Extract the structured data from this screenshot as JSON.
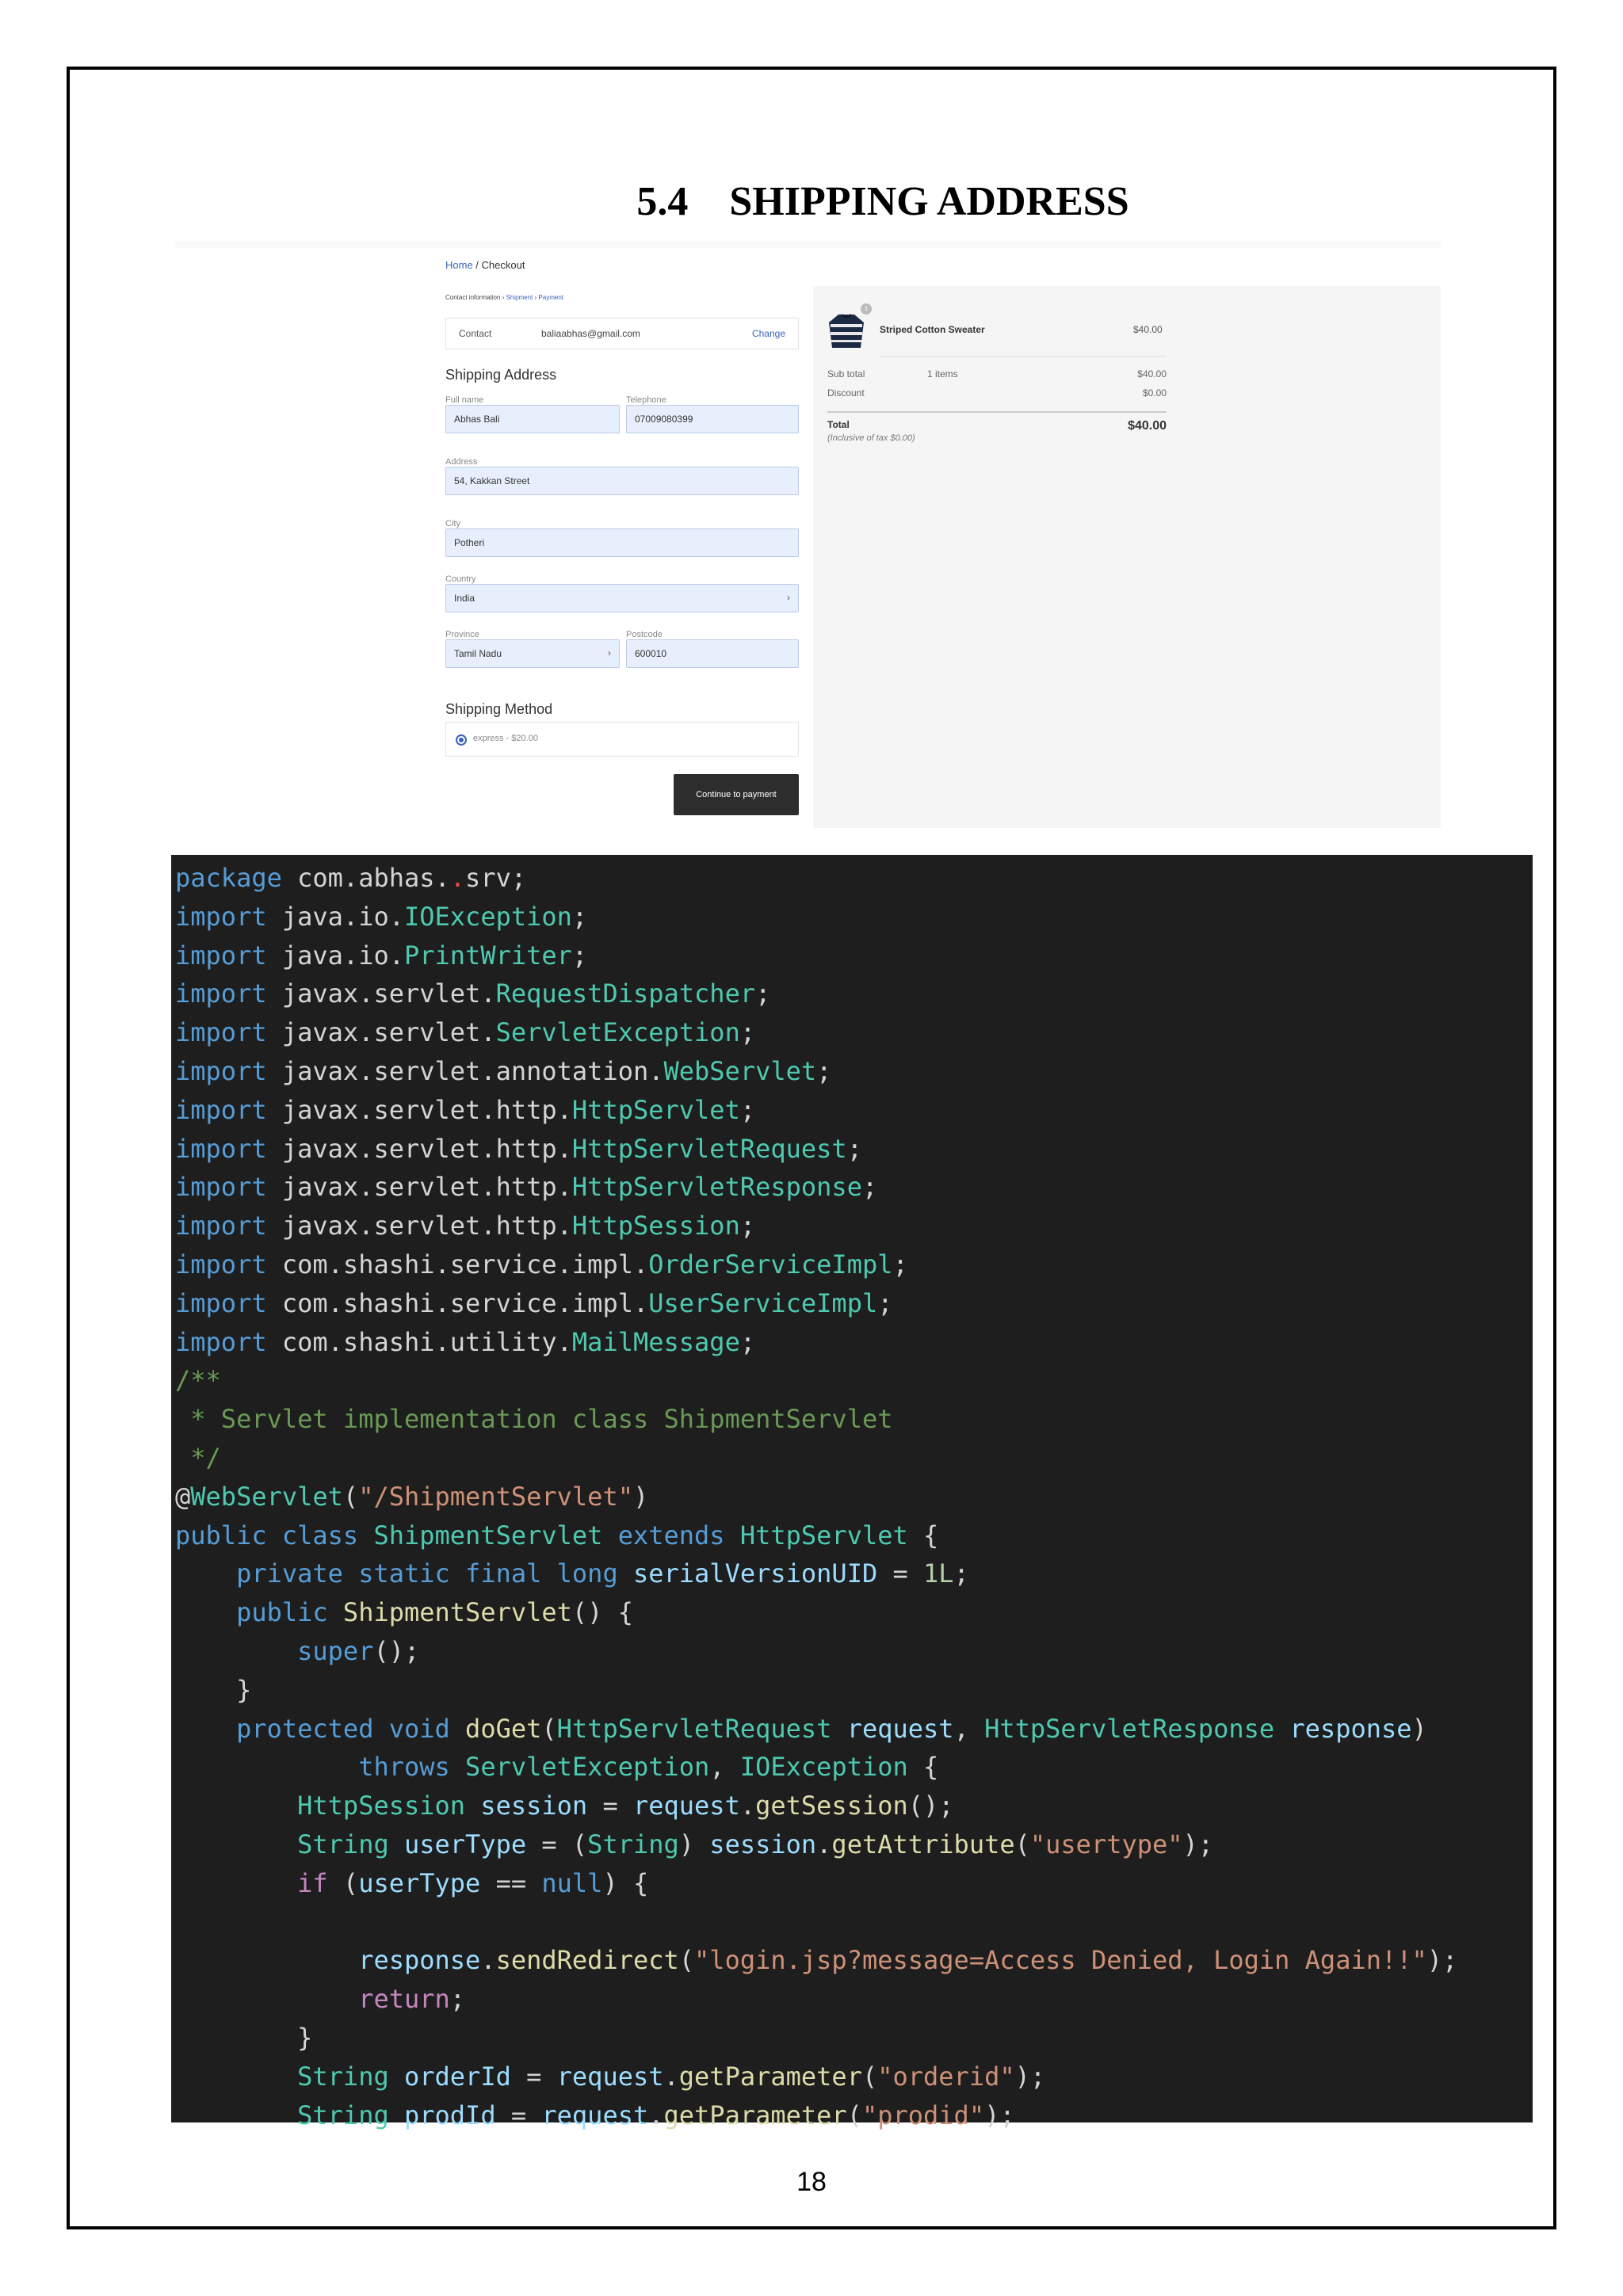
{
  "heading": {
    "number": "5.4",
    "title": "SHIPPING ADDRESS"
  },
  "screenshot": {
    "breadcrumb": {
      "home": "Home",
      "sep": " / ",
      "current": "Checkout"
    },
    "steps": [
      {
        "label": "Contact information",
        "link": false
      },
      {
        "label": "Shipment",
        "link": true
      },
      {
        "label": "Payment",
        "link": true
      }
    ],
    "contact": {
      "label": "Contact",
      "email": "baliaabhas@gmail.com",
      "change": "Change"
    },
    "shipping_title": "Shipping Address",
    "fields": {
      "full_name": {
        "label": "Full name",
        "value": "Abhas Bali"
      },
      "telephone": {
        "label": "Telephone",
        "value": "07009080399"
      },
      "address": {
        "label": "Address",
        "value": "54, Kakkan Street"
      },
      "city": {
        "label": "City",
        "value": "Potheri"
      },
      "country": {
        "label": "Country",
        "value": "India"
      },
      "province": {
        "label": "Province",
        "value": "Tamil Nadu"
      },
      "postcode": {
        "label": "Postcode",
        "value": "600010"
      }
    },
    "method_title": "Shipping Method",
    "method_option": "express - $20.00",
    "continue_label": "Continue to payment",
    "summary": {
      "qty": "1",
      "product": "Striped Cotton Sweater",
      "product_price": "$40.00",
      "subtotal_label": "Sub total",
      "items": "1 items",
      "subtotal": "$40.00",
      "discount_label": "Discount",
      "discount": "$0.00",
      "total_label": "Total",
      "total": "$40.00",
      "tax_note": "(Inclusive of tax $0.00)"
    }
  },
  "code_colors": {
    "kw": "#569cd6",
    "type": "#4ec9b0",
    "str": "#ce9178",
    "cmt": "#6a9955",
    "var": "#9cdcfe",
    "fn": "#dcdcaa",
    "ctl": "#c586c0",
    "num": "#b5cea8",
    "plain": "#d4d4d4",
    "err": "#f44747"
  },
  "code_lines": [
    [
      [
        "kw",
        "package"
      ],
      [
        "plain",
        " com.abhas."
      ],
      [
        "err",
        "."
      ],
      [
        "plain",
        "srv;"
      ]
    ],
    [
      [
        "kw",
        "import"
      ],
      [
        "plain",
        " java.io."
      ],
      [
        "type",
        "IOException"
      ],
      [
        "plain",
        ";"
      ]
    ],
    [
      [
        "kw",
        "import"
      ],
      [
        "plain",
        " java.io."
      ],
      [
        "type",
        "PrintWriter"
      ],
      [
        "plain",
        ";"
      ]
    ],
    [
      [
        "kw",
        "import"
      ],
      [
        "plain",
        " javax.servlet."
      ],
      [
        "type",
        "RequestDispatcher"
      ],
      [
        "plain",
        ";"
      ]
    ],
    [
      [
        "kw",
        "import"
      ],
      [
        "plain",
        " javax.servlet."
      ],
      [
        "type",
        "ServletException"
      ],
      [
        "plain",
        ";"
      ]
    ],
    [
      [
        "kw",
        "import"
      ],
      [
        "plain",
        " javax.servlet.annotation."
      ],
      [
        "type",
        "WebServlet"
      ],
      [
        "plain",
        ";"
      ]
    ],
    [
      [
        "kw",
        "import"
      ],
      [
        "plain",
        " javax.servlet.http."
      ],
      [
        "type",
        "HttpServlet"
      ],
      [
        "plain",
        ";"
      ]
    ],
    [
      [
        "kw",
        "import"
      ],
      [
        "plain",
        " javax.servlet.http."
      ],
      [
        "type",
        "HttpServletRequest"
      ],
      [
        "plain",
        ";"
      ]
    ],
    [
      [
        "kw",
        "import"
      ],
      [
        "plain",
        " javax.servlet.http."
      ],
      [
        "type",
        "HttpServletResponse"
      ],
      [
        "plain",
        ";"
      ]
    ],
    [
      [
        "kw",
        "import"
      ],
      [
        "plain",
        " javax.servlet.http."
      ],
      [
        "type",
        "HttpSession"
      ],
      [
        "plain",
        ";"
      ]
    ],
    [
      [
        "kw",
        "import"
      ],
      [
        "plain",
        " com.shashi.service.impl."
      ],
      [
        "type",
        "OrderServiceImpl"
      ],
      [
        "plain",
        ";"
      ]
    ],
    [
      [
        "kw",
        "import"
      ],
      [
        "plain",
        " com.shashi.service.impl."
      ],
      [
        "type",
        "UserServiceImpl"
      ],
      [
        "plain",
        ";"
      ]
    ],
    [
      [
        "kw",
        "import"
      ],
      [
        "plain",
        " com.shashi.utility."
      ],
      [
        "type",
        "MailMessage"
      ],
      [
        "plain",
        ";"
      ]
    ],
    [
      [
        "cmt",
        "/**"
      ]
    ],
    [
      [
        "cmt",
        " * Servlet implementation class ShipmentServlet"
      ]
    ],
    [
      [
        "cmt",
        " */"
      ]
    ],
    [
      [
        "plain",
        "@"
      ],
      [
        "type",
        "WebServlet"
      ],
      [
        "plain",
        "("
      ],
      [
        "str",
        "\"/ShipmentServlet\""
      ],
      [
        "plain",
        ")"
      ]
    ],
    [
      [
        "kw",
        "public"
      ],
      [
        "plain",
        " "
      ],
      [
        "kw",
        "class"
      ],
      [
        "plain",
        " "
      ],
      [
        "type",
        "ShipmentServlet"
      ],
      [
        "plain",
        " "
      ],
      [
        "kw",
        "extends"
      ],
      [
        "plain",
        " "
      ],
      [
        "type",
        "HttpServlet"
      ],
      [
        "plain",
        " {"
      ]
    ],
    [
      [
        "plain",
        "    "
      ],
      [
        "kw",
        "private"
      ],
      [
        "plain",
        " "
      ],
      [
        "kw",
        "static"
      ],
      [
        "plain",
        " "
      ],
      [
        "kw",
        "final"
      ],
      [
        "plain",
        " "
      ],
      [
        "kw",
        "long"
      ],
      [
        "plain",
        " "
      ],
      [
        "var",
        "serialVersionUID"
      ],
      [
        "plain",
        " = "
      ],
      [
        "num",
        "1L"
      ],
      [
        "plain",
        ";"
      ]
    ],
    [
      [
        "plain",
        "    "
      ],
      [
        "kw",
        "public"
      ],
      [
        "plain",
        " "
      ],
      [
        "fn",
        "ShipmentServlet"
      ],
      [
        "plain",
        "() {"
      ]
    ],
    [
      [
        "plain",
        "        "
      ],
      [
        "kw",
        "super"
      ],
      [
        "plain",
        "();"
      ]
    ],
    [
      [
        "plain",
        "    }"
      ]
    ],
    [
      [
        "plain",
        "    "
      ],
      [
        "kw",
        "protected"
      ],
      [
        "plain",
        " "
      ],
      [
        "kw",
        "void"
      ],
      [
        "plain",
        " "
      ],
      [
        "fn",
        "doGet"
      ],
      [
        "plain",
        "("
      ],
      [
        "type",
        "HttpServletRequest"
      ],
      [
        "plain",
        " "
      ],
      [
        "var",
        "request"
      ],
      [
        "plain",
        ", "
      ],
      [
        "type",
        "HttpServletResponse"
      ],
      [
        "plain",
        " "
      ],
      [
        "var",
        "response"
      ],
      [
        "plain",
        ")"
      ]
    ],
    [
      [
        "plain",
        "            "
      ],
      [
        "kw",
        "throws"
      ],
      [
        "plain",
        " "
      ],
      [
        "type",
        "ServletException"
      ],
      [
        "plain",
        ", "
      ],
      [
        "type",
        "IOException"
      ],
      [
        "plain",
        " {"
      ]
    ],
    [
      [
        "plain",
        "        "
      ],
      [
        "type",
        "HttpSession"
      ],
      [
        "plain",
        " "
      ],
      [
        "var",
        "session"
      ],
      [
        "plain",
        " = "
      ],
      [
        "var",
        "request"
      ],
      [
        "plain",
        "."
      ],
      [
        "fn",
        "getSession"
      ],
      [
        "plain",
        "();"
      ]
    ],
    [
      [
        "plain",
        "        "
      ],
      [
        "type",
        "String"
      ],
      [
        "plain",
        " "
      ],
      [
        "var",
        "userType"
      ],
      [
        "plain",
        " = ("
      ],
      [
        "type",
        "String"
      ],
      [
        "plain",
        ") "
      ],
      [
        "var",
        "session"
      ],
      [
        "plain",
        "."
      ],
      [
        "fn",
        "getAttribute"
      ],
      [
        "plain",
        "("
      ],
      [
        "str",
        "\"usertype\""
      ],
      [
        "plain",
        ");"
      ]
    ],
    [
      [
        "plain",
        "        "
      ],
      [
        "ctl",
        "if"
      ],
      [
        "plain",
        " ("
      ],
      [
        "var",
        "userType"
      ],
      [
        "plain",
        " == "
      ],
      [
        "kw",
        "null"
      ],
      [
        "plain",
        ") {"
      ]
    ],
    [
      [
        "plain",
        ""
      ]
    ],
    [
      [
        "plain",
        "            "
      ],
      [
        "var",
        "response"
      ],
      [
        "plain",
        "."
      ],
      [
        "fn",
        "sendRedirect"
      ],
      [
        "plain",
        "("
      ],
      [
        "str",
        "\"login.jsp?message=Access Denied, Login Again!!\""
      ],
      [
        "plain",
        ");"
      ]
    ],
    [
      [
        "plain",
        "            "
      ],
      [
        "ctl",
        "return"
      ],
      [
        "plain",
        ";"
      ]
    ],
    [
      [
        "plain",
        "        }"
      ]
    ],
    [
      [
        "plain",
        "        "
      ],
      [
        "type",
        "String"
      ],
      [
        "plain",
        " "
      ],
      [
        "var",
        "orderId"
      ],
      [
        "plain",
        " = "
      ],
      [
        "var",
        "request"
      ],
      [
        "plain",
        "."
      ],
      [
        "fn",
        "getParameter"
      ],
      [
        "plain",
        "("
      ],
      [
        "str",
        "\"orderid\""
      ],
      [
        "plain",
        ");"
      ]
    ],
    [
      [
        "plain",
        "        "
      ],
      [
        "type",
        "String"
      ],
      [
        "plain",
        " "
      ],
      [
        "var",
        "prodId"
      ],
      [
        "plain",
        " = "
      ],
      [
        "var",
        "request"
      ],
      [
        "plain",
        "."
      ],
      [
        "fn",
        "getParameter"
      ],
      [
        "plain",
        "("
      ],
      [
        "str",
        "\"prodid\""
      ],
      [
        "plain",
        ");"
      ]
    ]
  ],
  "page_number": "18"
}
